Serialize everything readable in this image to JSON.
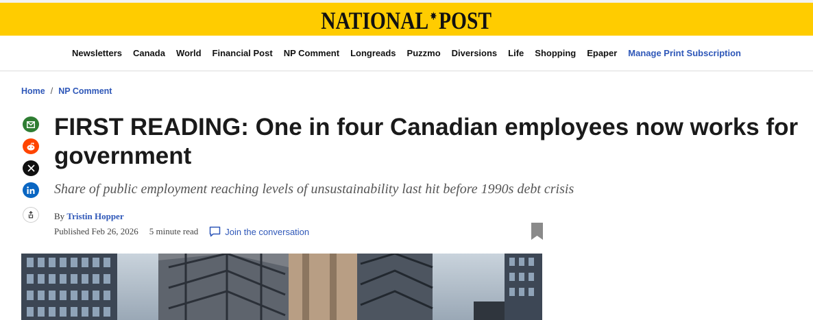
{
  "masthead": {
    "logo_left": "NATIONAL",
    "logo_right": "POST",
    "logo_leaf_icon": "maple-leaf-icon",
    "background": "#ffcc00"
  },
  "nav": {
    "items": [
      "Newsletters",
      "Canada",
      "World",
      "Financial Post",
      "NP Comment",
      "Longreads",
      "Puzzmo",
      "Diversions",
      "Life",
      "Shopping",
      "Epaper"
    ],
    "accent_item": "Manage Print Subscription",
    "accent_color": "#2e57b8"
  },
  "breadcrumb": {
    "home": "Home",
    "separator": "/",
    "section": "NP Comment"
  },
  "share": {
    "icons": [
      "email-icon",
      "reddit-icon",
      "x-icon",
      "linkedin-icon",
      "share-more-icon"
    ]
  },
  "article": {
    "headline": "FIRST READING: One in four Canadian employees now works for government",
    "dek": "Share of public employment reaching levels of unsustainability last hit before 1990s debt crisis",
    "by_prefix": "By",
    "author": "Tristin Hopper",
    "published": "Published Feb 26, 2026",
    "read_time": "5 minute read",
    "conversation": "Join the conversation"
  }
}
